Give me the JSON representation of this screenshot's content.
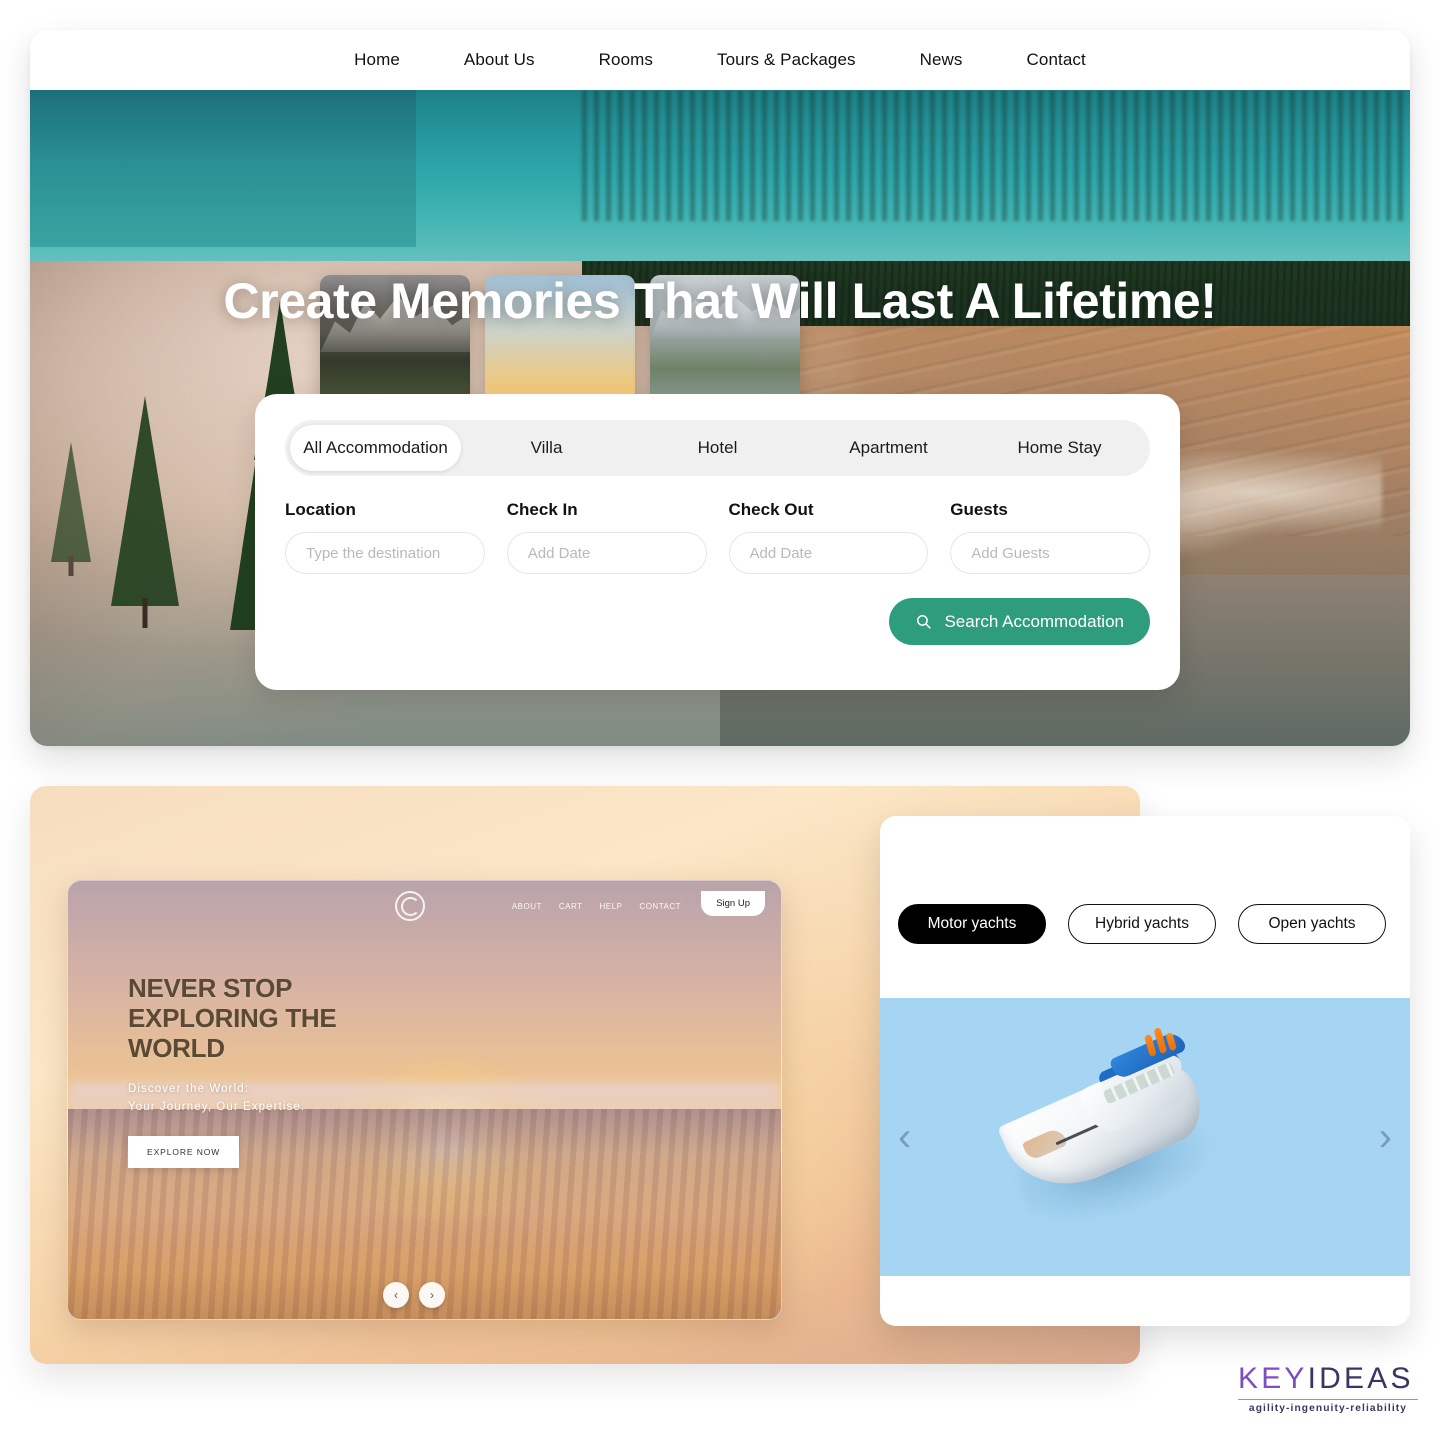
{
  "nav": {
    "items": [
      {
        "label": "Home"
      },
      {
        "label": "About Us"
      },
      {
        "label": "Rooms"
      },
      {
        "label": "Tours & Packages"
      },
      {
        "label": "News"
      },
      {
        "label": "Contact"
      }
    ]
  },
  "hero": {
    "title": "Create Memories That Will Last A Lifetime!"
  },
  "search": {
    "tabs": [
      {
        "label": "All Accommodation",
        "active": true
      },
      {
        "label": "Villa",
        "active": false
      },
      {
        "label": "Hotel",
        "active": false
      },
      {
        "label": "Apartment",
        "active": false
      },
      {
        "label": "Home Stay",
        "active": false
      }
    ],
    "fields": [
      {
        "label": "Location",
        "placeholder": "Type the destination",
        "value": ""
      },
      {
        "label": "Check In",
        "placeholder": "Add Date",
        "value": ""
      },
      {
        "label": "Check Out",
        "placeholder": "Add Date",
        "value": ""
      },
      {
        "label": "Guests",
        "placeholder": "Add Guests",
        "value": ""
      }
    ],
    "button_label": "Search Accommodation",
    "button_icon": "search-icon",
    "button_color": "#2e9d7e"
  },
  "showcase": {
    "mock_nav": {
      "links": [
        {
          "label": "ABOUT"
        },
        {
          "label": "CART"
        },
        {
          "label": "HELP"
        },
        {
          "label": "CONTACT"
        }
      ],
      "signup_label": "Sign Up",
      "logo_icon": "spiral-logo-icon"
    },
    "headline": "NEVER STOP EXPLORING THE WORLD",
    "subhead_line1": "Discover the World:",
    "subhead_line2": "Your Journey, Our Expertise.",
    "cta_label": "EXPLORE NOW",
    "thumbnails": [
      {
        "name": "alpine-village-thumbnail"
      },
      {
        "name": "overwater-bungalow-sunset-thumbnail"
      },
      {
        "name": "mountain-lake-hiker-thumbnail"
      }
    ],
    "carousel": {
      "prev_icon": "chevron-left-icon",
      "next_icon": "chevron-right-icon",
      "prev_glyph": "‹",
      "next_glyph": "›"
    }
  },
  "yacht": {
    "tabs": [
      {
        "label": "Motor yachts",
        "active": true
      },
      {
        "label": "Hybrid yachts",
        "active": false
      },
      {
        "label": "Open yachts",
        "active": false
      }
    ],
    "carousel": {
      "prev_glyph": "‹",
      "next_glyph": "›"
    },
    "stage_color": "#a5d5f2",
    "product_name": "motor-yacht-render"
  },
  "brand": {
    "part1": "KEY",
    "part2": "IDEAS",
    "tagline": "agility-ingenuity-reliability",
    "color_primary": "#7c4fc0",
    "color_secondary": "#3c3560"
  }
}
